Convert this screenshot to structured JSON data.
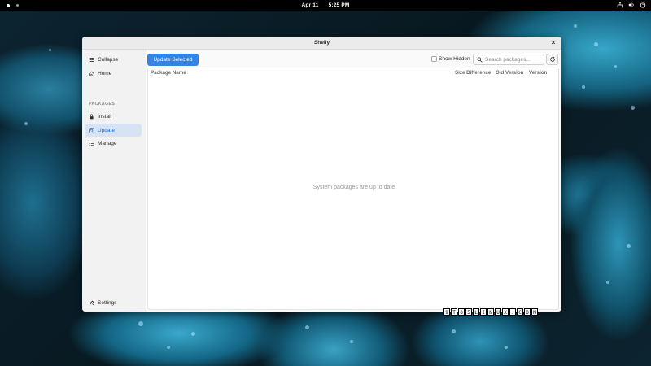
{
  "topbar": {
    "date": "Apr 11",
    "time": "5:25 PM",
    "icons": [
      "network-icon",
      "volume-icon",
      "power-icon"
    ]
  },
  "window": {
    "title": "Shelly",
    "close": "×"
  },
  "sidebar": {
    "collapse_label": "Collapse",
    "home_label": "Home",
    "section_label": "PACKAGES",
    "items": [
      {
        "label": "Install",
        "icon": "lock-icon"
      },
      {
        "label": "Update",
        "icon": "update-icon",
        "active": true
      },
      {
        "label": "Manage",
        "icon": "list-icon"
      }
    ],
    "settings_label": "Settings"
  },
  "toolbar": {
    "update_selected": "Update Selected",
    "show_hidden": "Show Hidden",
    "search_placeholder": "Search packages..."
  },
  "table": {
    "columns": [
      "Package Name",
      "Size Difference",
      "Old Version",
      "Version"
    ],
    "empty_message": "System packages are up to date"
  },
  "watermark": [
    "9",
    "T",
    "O",
    "5",
    "L",
    "I",
    "N",
    "U",
    "X",
    ".",
    "C",
    "O",
    "M"
  ],
  "colors": {
    "accent": "#3584e4",
    "active_bg": "#d5e3f5",
    "active_text": "#1c6bd0"
  }
}
